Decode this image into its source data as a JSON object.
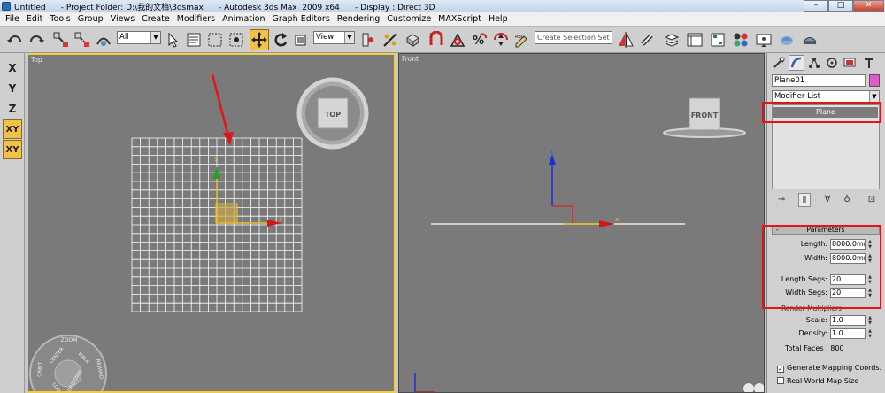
{
  "window": {
    "title": "Untitled      - Project Folder: D:\\我的文档\\3dsmax      - Autodesk 3ds Max  2009 x64      - Display : Direct 3D",
    "minimize": "–",
    "maximize": "□",
    "close": "✕"
  },
  "menu": [
    "File",
    "Edit",
    "Tools",
    "Group",
    "Views",
    "Create",
    "Modifiers",
    "Animation",
    "Graph Editors",
    "Rendering",
    "Customize",
    "MAXScript",
    "Help"
  ],
  "toolbar": {
    "selection_filter": "All",
    "reference_coord": "View",
    "named_selection_placeholder": "Create Selection Set"
  },
  "axis_constraints": {
    "x": "X",
    "y": "Y",
    "z": "Z",
    "xy": "XY",
    "xy_cycle": "XY"
  },
  "viewports": {
    "top": {
      "label": "Top",
      "viewcube": "TOP",
      "axis_x": "x",
      "axis_y": "y",
      "nav_wheel": [
        "ZOOM",
        "ORBIT",
        "CENTER",
        "WALK",
        "REWIND",
        "LOOK",
        "UP/DOWN"
      ]
    },
    "front": {
      "label": "Front",
      "viewcube": "FRONT",
      "axis_x": "x",
      "axis_z": "z"
    }
  },
  "command_panel": {
    "object_name": "Plane01",
    "object_color": "#e05cc8",
    "modifier_list": "Modifier List",
    "stack_item": "Plane",
    "rollout_title": "Parameters",
    "length_label": "Length:",
    "length_value": "8000.0mm",
    "width_label": "Width:",
    "width_value": "8000.0mm",
    "length_segs_label": "Length Segs:",
    "length_segs_value": "20",
    "width_segs_label": "Width Segs:",
    "width_segs_value": "20",
    "render_multipliers": "Render Multipliers",
    "scale_label": "Scale:",
    "scale_value": "1.0",
    "density_label": "Density:",
    "density_value": "1.0",
    "total_faces": "Total Faces : 800",
    "generate_mapping": "Generate Mapping Coords.",
    "generate_mapping_checked": true,
    "real_world_map": "Real-World Map Size",
    "real_world_checked": false
  },
  "colors": {
    "active_viewport_border": "#f0d040",
    "annotation_red": "#e0161c",
    "grid_white": "#ffffff",
    "gizmo_yellow": "#e8c030"
  }
}
